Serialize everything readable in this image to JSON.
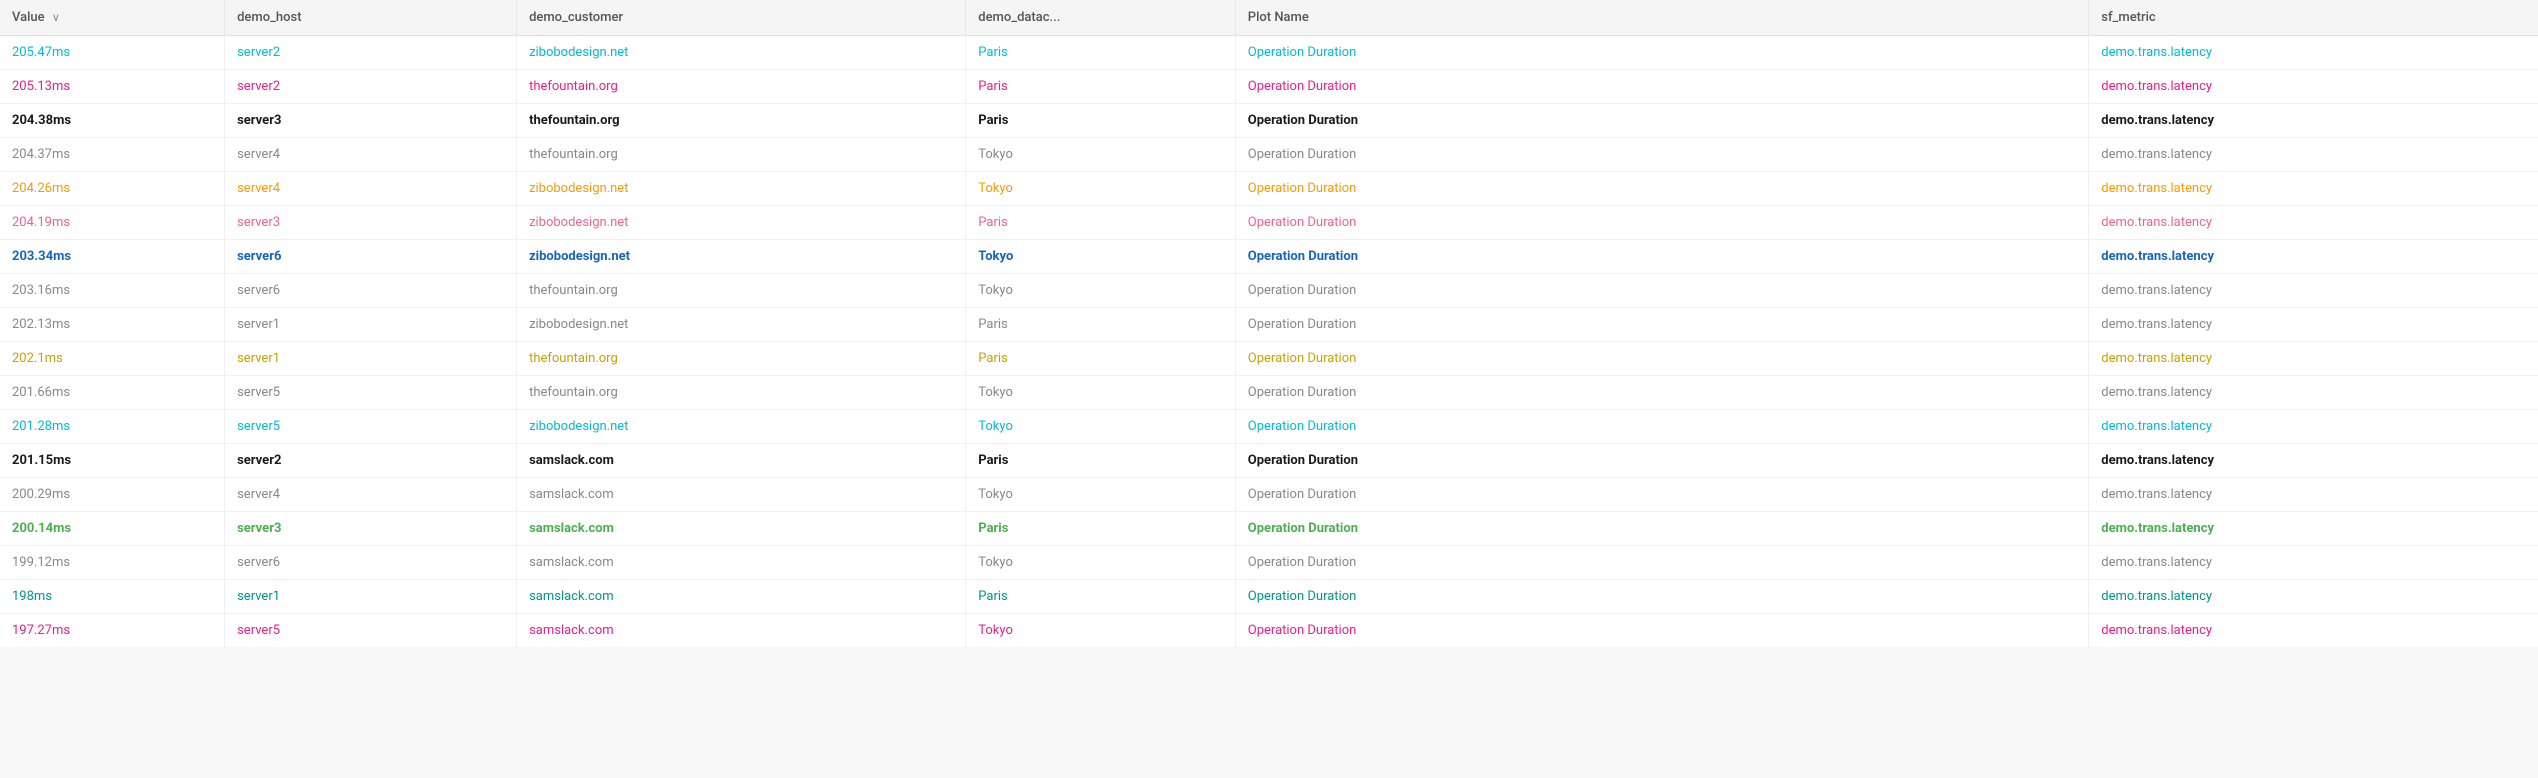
{
  "table": {
    "columns": [
      {
        "id": "value",
        "label": "Value",
        "sort": "desc"
      },
      {
        "id": "demo_host",
        "label": "demo_host"
      },
      {
        "id": "demo_customer",
        "label": "demo_customer"
      },
      {
        "id": "demo_datac",
        "label": "demo_datac..."
      },
      {
        "id": "plot_name",
        "label": "Plot Name"
      },
      {
        "id": "sf_metric",
        "label": "sf_metric"
      }
    ],
    "rows": [
      {
        "value": "205.47ms",
        "demo_host": "server2",
        "demo_customer": "zibobodesign.net",
        "demo_datac": "Paris",
        "plot_name": "Operation Duration",
        "sf_metric": "demo.trans.latency",
        "color": "cyan"
      },
      {
        "value": "205.13ms",
        "demo_host": "server2",
        "demo_customer": "thefountain.org",
        "demo_datac": "Paris",
        "plot_name": "Operation Duration",
        "sf_metric": "demo.trans.latency",
        "color": "magenta"
      },
      {
        "value": "204.38ms",
        "demo_host": "server3",
        "demo_customer": "thefountain.org",
        "demo_datac": "Paris",
        "plot_name": "Operation Duration",
        "sf_metric": "demo.trans.latency",
        "color": "dark"
      },
      {
        "value": "204.37ms",
        "demo_host": "server4",
        "demo_customer": "thefountain.org",
        "demo_datac": "Tokyo",
        "plot_name": "Operation Duration",
        "sf_metric": "demo.trans.latency",
        "color": "gray"
      },
      {
        "value": "204.26ms",
        "demo_host": "server4",
        "demo_customer": "zibobodesign.net",
        "demo_datac": "Tokyo",
        "plot_name": "Operation Duration",
        "sf_metric": "demo.trans.latency",
        "color": "orange"
      },
      {
        "value": "204.19ms",
        "demo_host": "server3",
        "demo_customer": "zibobodesign.net",
        "demo_datac": "Paris",
        "plot_name": "Operation Duration",
        "sf_metric": "demo.trans.latency",
        "color": "pink"
      },
      {
        "value": "203.34ms",
        "demo_host": "server6",
        "demo_customer": "zibobodesign.net",
        "demo_datac": "Tokyo",
        "plot_name": "Operation Duration",
        "sf_metric": "demo.trans.latency",
        "color": "blue-bold"
      },
      {
        "value": "203.16ms",
        "demo_host": "server6",
        "demo_customer": "thefountain.org",
        "demo_datac": "Tokyo",
        "plot_name": "Operation Duration",
        "sf_metric": "demo.trans.latency",
        "color": "gray"
      },
      {
        "value": "202.13ms",
        "demo_host": "server1",
        "demo_customer": "zibobodesign.net",
        "demo_datac": "Paris",
        "plot_name": "Operation Duration",
        "sf_metric": "demo.trans.latency",
        "color": "gray"
      },
      {
        "value": "202.1ms",
        "demo_host": "server1",
        "demo_customer": "thefountain.org",
        "demo_datac": "Paris",
        "plot_name": "Operation Duration",
        "sf_metric": "demo.trans.latency",
        "color": "yellow"
      },
      {
        "value": "201.66ms",
        "demo_host": "server5",
        "demo_customer": "thefountain.org",
        "demo_datac": "Tokyo",
        "plot_name": "Operation Duration",
        "sf_metric": "demo.trans.latency",
        "color": "gray"
      },
      {
        "value": "201.28ms",
        "demo_host": "server5",
        "demo_customer": "zibobodesign.net",
        "demo_datac": "Tokyo",
        "plot_name": "Operation Duration",
        "sf_metric": "demo.trans.latency",
        "color": "cyan"
      },
      {
        "value": "201.15ms",
        "demo_host": "server2",
        "demo_customer": "samslack.com",
        "demo_datac": "Paris",
        "plot_name": "Operation Duration",
        "sf_metric": "demo.trans.latency",
        "color": "dark"
      },
      {
        "value": "200.29ms",
        "demo_host": "server4",
        "demo_customer": "samslack.com",
        "demo_datac": "Tokyo",
        "plot_name": "Operation Duration",
        "sf_metric": "demo.trans.latency",
        "color": "gray"
      },
      {
        "value": "200.14ms",
        "demo_host": "server3",
        "demo_customer": "samslack.com",
        "demo_datac": "Paris",
        "plot_name": "Operation Duration",
        "sf_metric": "demo.trans.latency",
        "color": "green"
      },
      {
        "value": "199.12ms",
        "demo_host": "server6",
        "demo_customer": "samslack.com",
        "demo_datac": "Tokyo",
        "plot_name": "Operation Duration",
        "sf_metric": "demo.trans.latency",
        "color": "gray"
      },
      {
        "value": "198ms",
        "demo_host": "server1",
        "demo_customer": "samslack.com",
        "demo_datac": "Paris",
        "plot_name": "Operation Duration",
        "sf_metric": "demo.trans.latency",
        "color": "teal"
      },
      {
        "value": "197.27ms",
        "demo_host": "server5",
        "demo_customer": "samslack.com",
        "demo_datac": "Tokyo",
        "plot_name": "Operation Duration",
        "sf_metric": "demo.trans.latency",
        "color": "magenta"
      }
    ]
  }
}
